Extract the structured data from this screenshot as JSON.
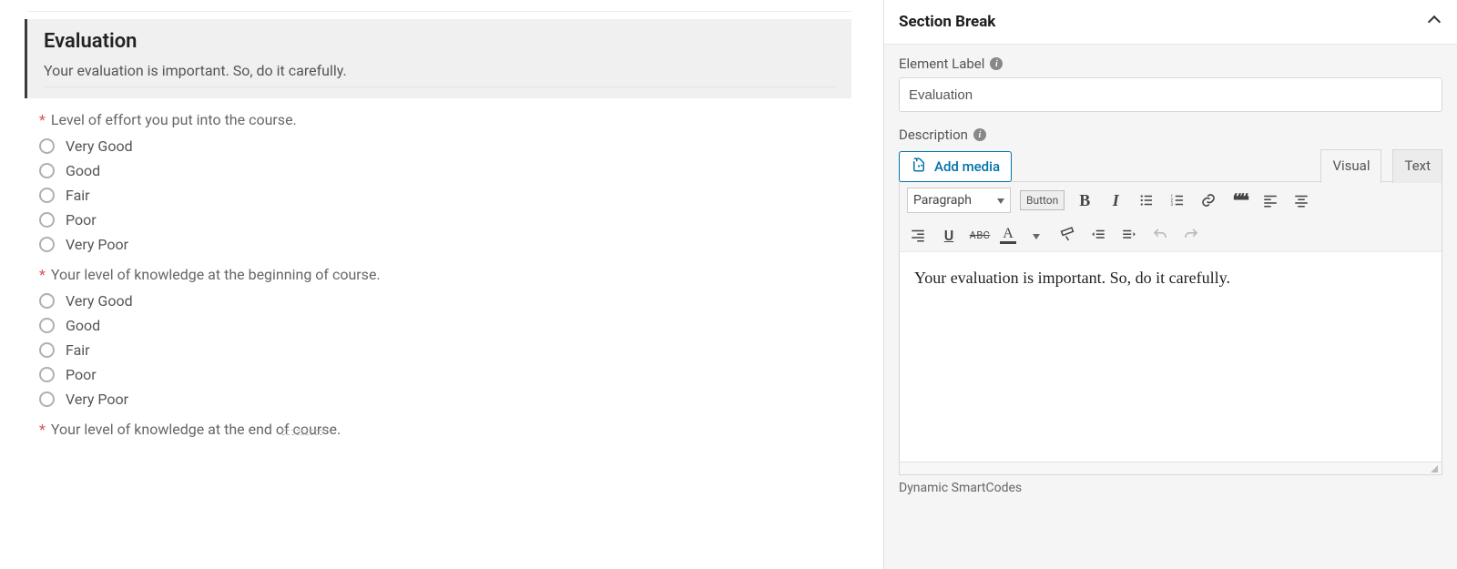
{
  "section": {
    "title": "Evaluation",
    "description": "Your evaluation is important. So, do it carefully."
  },
  "questions": [
    {
      "label": "Level of effort you put into the course.",
      "options": [
        "Very Good",
        "Good",
        "Fair",
        "Poor",
        "Very Poor"
      ]
    },
    {
      "label": "Your level of knowledge at the beginning of course.",
      "options": [
        "Very Good",
        "Good",
        "Fair",
        "Poor",
        "Very Poor"
      ]
    },
    {
      "label": "Your level of knowledge at the end of course.",
      "options": []
    }
  ],
  "panel": {
    "title": "Section Break",
    "elementLabelTitle": "Element Label",
    "elementLabelValue": "Evaluation",
    "descriptionTitle": "Description",
    "addMedia": "Add media",
    "tabVisual": "Visual",
    "tabText": "Text",
    "formatSelect": "Paragraph",
    "buttonChip": "Button",
    "editorContent": "Your evaluation is important. So, do it carefully.",
    "smartcodes": "Dynamic SmartCodes"
  },
  "icons": {
    "bold": "B",
    "italic": "I",
    "underline": "U",
    "strike": "ABC",
    "textcolor": "A",
    "link": "link",
    "quote": "❝❝",
    "undo": "↶",
    "redo": "↷"
  }
}
